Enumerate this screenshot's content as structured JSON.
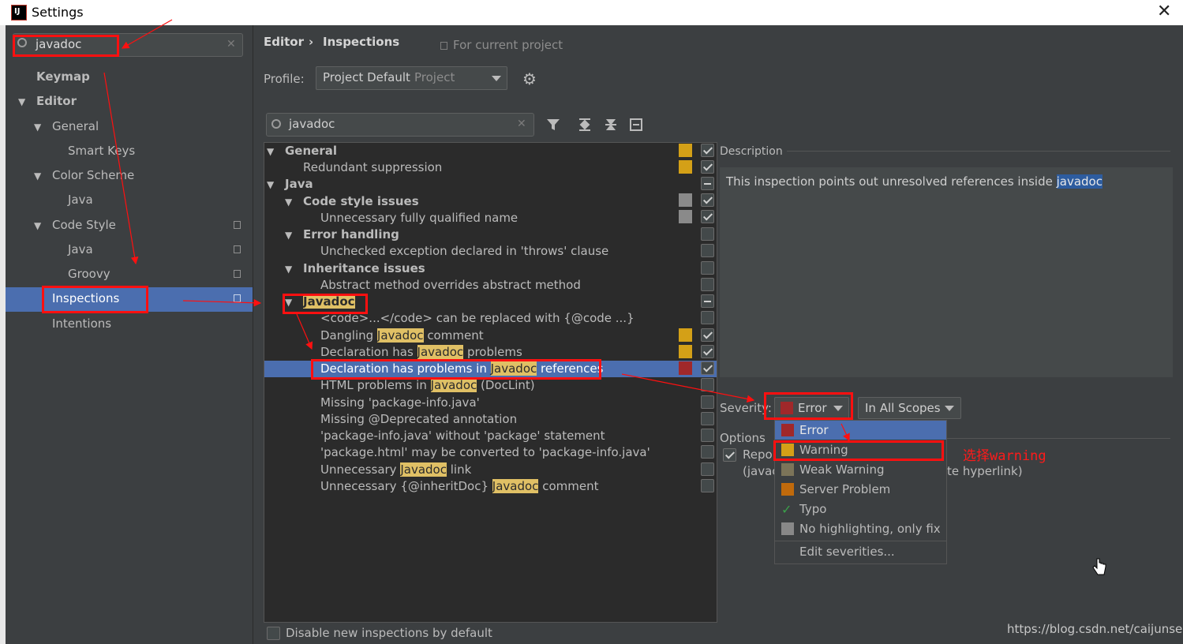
{
  "window": {
    "title": "Settings"
  },
  "sidebar": {
    "search_value": "javadoc",
    "items": [
      {
        "label": "Keymap"
      },
      {
        "label": "Editor"
      },
      {
        "label": "General"
      },
      {
        "label": "Smart Keys"
      },
      {
        "label": "Color Scheme"
      },
      {
        "label": "Java"
      },
      {
        "label": "Code Style"
      },
      {
        "label": "Java"
      },
      {
        "label": "Groovy"
      },
      {
        "label": "Inspections"
      },
      {
        "label": "Intentions"
      }
    ]
  },
  "breadcrumb": {
    "first": "Editor",
    "separator": "›",
    "second": "Inspections",
    "scope": "For current project"
  },
  "profile": {
    "label": "Profile:",
    "value": "Project Default",
    "value_note": "Project"
  },
  "filter": {
    "value": "javadoc"
  },
  "tree": [
    {
      "text": "General",
      "bold": true
    },
    {
      "text": "Redundant suppression"
    },
    {
      "text": "Java",
      "bold": true
    },
    {
      "text": "Code style issues",
      "bold": true
    },
    {
      "text": "Unnecessary fully qualified name"
    },
    {
      "text": "Error handling",
      "bold": true
    },
    {
      "text": "Unchecked exception declared in 'throws' clause"
    },
    {
      "text": "Inheritance issues",
      "bold": true
    },
    {
      "text": "Abstract method overrides abstract method"
    },
    {
      "text": "Javadoc",
      "bold": true
    },
    {
      "text": "<code>...</code> can be replaced with {@code ...}"
    },
    {
      "pre": "Dangling ",
      "hl": "Javadoc",
      "post": " comment"
    },
    {
      "pre": "Declaration has ",
      "hl": "Javadoc",
      "post": " problems"
    },
    {
      "pre": "Declaration has problems in ",
      "hl": "Javadoc",
      "post": " references"
    },
    {
      "pre": "HTML problems in ",
      "hl": "Javadoc",
      "post": " (DocLint)"
    },
    {
      "text": "Missing 'package-info.java'"
    },
    {
      "text": "Missing @Deprecated annotation"
    },
    {
      "text": "'package-info.java' without 'package' statement"
    },
    {
      "text": "'package.html' may be converted to 'package-info.java'"
    },
    {
      "pre": "Unnecessary ",
      "hl": "Javadoc",
      "post": " link"
    },
    {
      "pre": "Unnecessary {@inheritDoc} ",
      "hl": "Javadoc",
      "post": " comment"
    }
  ],
  "description": {
    "header": "Description",
    "text_before": "This inspection points out unresolved references inside ",
    "highlight": "javadoc"
  },
  "severity": {
    "label": "Severity:",
    "value": "Error",
    "scope": "In All Scopes"
  },
  "options": {
    "header": "Options",
    "line1": "Repo",
    "line2": "(javac",
    "line2_right": "te hyperlink)"
  },
  "severity_menu": [
    {
      "label": "Error",
      "color": "#a0282a"
    },
    {
      "label": "Warning",
      "color": "#d4a017"
    },
    {
      "label": "Weak Warning",
      "color": "#7c7459"
    },
    {
      "label": "Server Problem",
      "color": "#c06a0c"
    },
    {
      "label": "Typo",
      "color": "#3aa04a"
    },
    {
      "label": "No highlighting, only fix",
      "color": "#888888"
    },
    {
      "label": "Edit severities..."
    }
  ],
  "annotation": {
    "text": "选择warning"
  },
  "footer": {
    "checkbox_label": "Disable new inspections by default"
  },
  "watermark": "https://blog.csdn.net/caijunsen"
}
